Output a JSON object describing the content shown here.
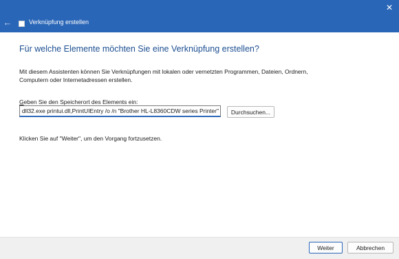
{
  "window": {
    "title": "Verknüpfung erstellen",
    "close_glyph": "✕",
    "back_glyph": "←",
    "accent_color": "#2a66b8"
  },
  "main": {
    "heading": "Für welche Elemente möchten Sie eine Verknüpfung erstellen?",
    "intro": "Mit diesem Assistenten können Sie Verknüpfungen mit lokalen oder vernetzten Programmen, Dateien, Ordnern, Computern oder Internetadressen erstellen.",
    "location_label": "Geben Sie den Speicherort des Elements ein:",
    "location_value": "dll32.exe printui.dll,PrintUIEntry /o /n \"Brother HL-L8360CDW series Printer\"",
    "browse_label": "Durchsuchen...",
    "hint": "Klicken Sie auf \"Weiter\", um den Vorgang fortzusetzen."
  },
  "footer": {
    "next_label": "Weiter",
    "cancel_label": "Abbrechen"
  }
}
